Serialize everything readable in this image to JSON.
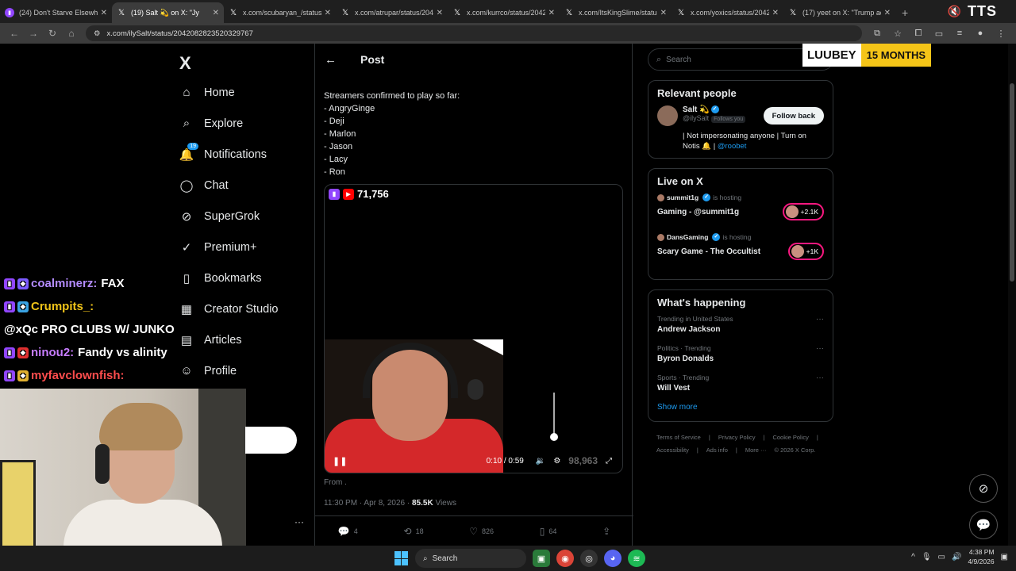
{
  "browser": {
    "tabs": [
      {
        "icon": "twitch-icon",
        "title": "(24) Don't Starve Elsewhere"
      },
      {
        "icon": "x-icon",
        "title": "(19) Salt 💫 on X: \"Jy",
        "active": true
      },
      {
        "icon": "x-icon",
        "title": "x.com/scubaryan_/status/"
      },
      {
        "icon": "x-icon",
        "title": "x.com/atrupar/status/2042"
      },
      {
        "icon": "x-icon",
        "title": "x.com/kurrco/status/2042"
      },
      {
        "icon": "x-icon",
        "title": "x.com/ItsKingSlime/status"
      },
      {
        "icon": "x-icon",
        "title": "x.com/yoxics/status/2042"
      },
      {
        "icon": "x-icon",
        "title": "(17) yeet on X: \"Trump ad"
      }
    ],
    "new_tab": "+",
    "url": "x.com/ilySalt/status/2042082823520329767"
  },
  "overlay": {
    "tts_label": "TTS",
    "sub_name": "LUUBEY",
    "sub_months": "15 MONTHS"
  },
  "sidebar": {
    "logo": "X",
    "items": [
      {
        "icon": "home-icon",
        "glyph": "⌂",
        "label": "Home"
      },
      {
        "icon": "search-icon",
        "glyph": "⌕",
        "label": "Explore"
      },
      {
        "icon": "bell-icon",
        "glyph": "🔔",
        "label": "Notifications",
        "badge": "19"
      },
      {
        "icon": "chat-bubble-icon",
        "glyph": "◯",
        "label": "Chat"
      },
      {
        "icon": "grok-icon",
        "glyph": "⊘",
        "label": "SuperGrok"
      },
      {
        "icon": "premium-icon",
        "glyph": "✓",
        "label": "Premium+"
      },
      {
        "icon": "bookmark-icon",
        "glyph": "▯",
        "label": "Bookmarks"
      },
      {
        "icon": "creator-studio-icon",
        "glyph": "▦",
        "label": "Creator Studio"
      },
      {
        "icon": "articles-icon",
        "glyph": "▤",
        "label": "Articles"
      },
      {
        "icon": "profile-icon",
        "glyph": "☺",
        "label": "Profile"
      }
    ],
    "more": "···"
  },
  "post": {
    "header_title": "Post",
    "lines": [
      "Streamers confirmed to play so far:",
      "- AngryGinge",
      "- Deji",
      "- Marlon",
      "- Jason",
      "- Lacy",
      "- Ron"
    ],
    "media": {
      "viewer_count": "71,756",
      "time": "0:10 / 0:59",
      "ghost_number": "98,963"
    },
    "from_label": "From .",
    "timestamp": "11:30 PM · Apr 8, 2026 · ",
    "views_count": "85.5K",
    "views_label": " Views",
    "actions": {
      "replies": "4",
      "reposts": "18",
      "likes": "826",
      "bookmarks": "64"
    }
  },
  "right": {
    "search_placeholder": "Search",
    "relevant": {
      "title": "Relevant people",
      "name": "Salt 💫",
      "handle": "@ilySalt",
      "follows_you": "Follows you",
      "button": "Follow back",
      "bio": "| Not impersonating anyone | Turn on Notis 🔔 | ",
      "bio_link": "@roobet"
    },
    "live": {
      "title": "Live on X",
      "items": [
        {
          "host": "summit1g",
          "hosting": "is hosting",
          "title": "Gaming - @summit1g",
          "count": "+2.1K"
        },
        {
          "host": "DansGaming",
          "hosting": "is hosting",
          "title": "Scary Game - The Occultist",
          "count": "+1K"
        }
      ]
    },
    "happening": {
      "title": "What's happening",
      "items": [
        {
          "category": "Trending in United States",
          "name": "Andrew Jackson"
        },
        {
          "category": "Politics · Trending",
          "name": "Byron Donalds"
        },
        {
          "category": "Sports · Trending",
          "name": "Will Vest"
        }
      ],
      "show_more": "Show more"
    },
    "footer": {
      "line1": [
        "Terms of Service",
        "|",
        "Privacy Policy",
        "|",
        "Cookie Policy",
        "|"
      ],
      "line2": [
        "Accessibility",
        "|",
        "Ads info",
        "|",
        "More ···",
        "© 2026 X Corp."
      ]
    }
  },
  "stream_chat": [
    {
      "user": "coalminerz:",
      "color": "#b48cff",
      "text": "FAX"
    },
    {
      "user": "Crumpits_:",
      "color": "#f0c419",
      "text": "@xQc PRO CLUBS W/ JUNKO"
    },
    {
      "user": "ninou2:",
      "color": "#c77dff",
      "text": "Fandy vs alinity"
    },
    {
      "user": "myfavclownfish:",
      "color": "#ff4d4d",
      "text": ""
    }
  ],
  "taskbar": {
    "search": "Search",
    "time": "4:38 PM",
    "date": "4/9/2026"
  }
}
